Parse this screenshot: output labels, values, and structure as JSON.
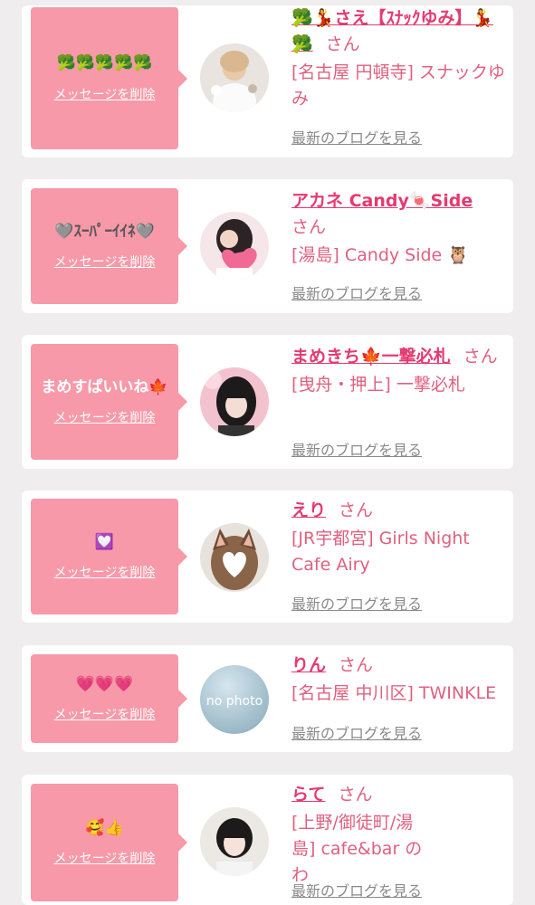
{
  "colors": {
    "background": "#efeded",
    "bubble": "#f799a9",
    "name": "#e53a6f",
    "shop": "#e0607f",
    "blog_link": "#8a8a8a"
  },
  "common": {
    "delete_label": "メッセージを削除",
    "san_label": "さん",
    "blog_label": "最新のブログを見る"
  },
  "messages": [
    {
      "message": "🥦🥦🥦🥦🥦",
      "name": "🥦💃さえ【ｽﾅｯｸゆみ】💃🥦",
      "shop": "[名古屋 円頓寺] スナックゆみ",
      "avatar": "photo-white-dress-icon"
    },
    {
      "message": "🩶ｽｰﾊﾟｰｲｲﾈ🩶",
      "name": "アカネ Candy🍬Side",
      "shop": "[湯島] Candy Side 🦉",
      "avatar": "photo-heart-pillow-icon"
    },
    {
      "message": "まめすぱいいね🍁",
      "name": "まめきち🍁一撃必札",
      "shop": "[曳舟・押上] 一撃必札",
      "avatar": "photo-dark-hair-icon"
    },
    {
      "message": "💟",
      "name": "えり",
      "shop": "[JR宇都宮] Girls Night Cafe Airy",
      "avatar": "photo-cat-ears-icon"
    },
    {
      "message": "💗💗💗",
      "name": "りん",
      "shop": "[名古屋 中川区] TWINKLE",
      "avatar": "no-photo-icon",
      "avatar_text": "no photo"
    },
    {
      "message": "🥰👍",
      "name": "らて",
      "shop": "[上野/御徒町/湯島] cafe&bar のわ",
      "avatar": "photo-short-hair-icon"
    }
  ]
}
